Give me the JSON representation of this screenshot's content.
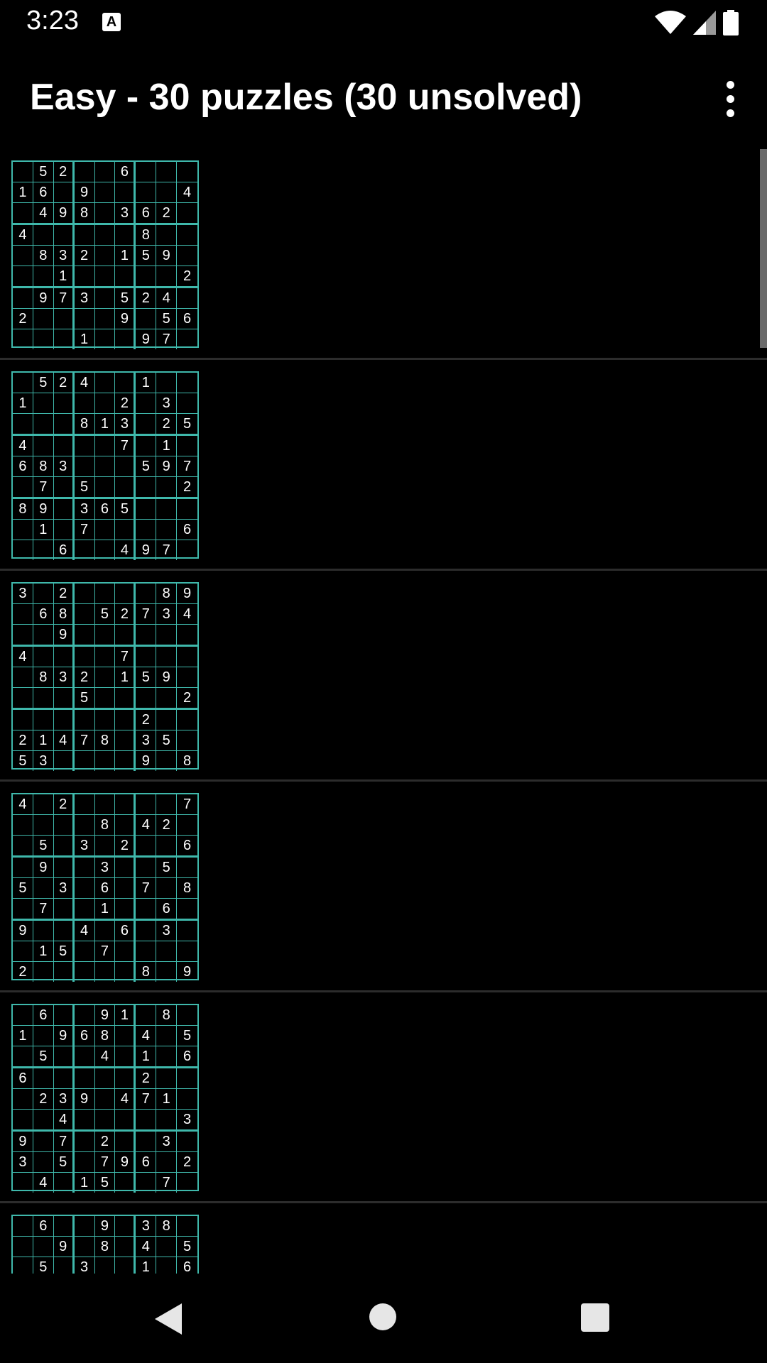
{
  "status_bar": {
    "time": "3:23",
    "notification_icon": "A",
    "icons": [
      "wifi-icon",
      "signal-icon",
      "battery-icon"
    ]
  },
  "app_bar": {
    "title": "Easy - 30 puzzles (30 unsolved)",
    "overflow_icon": "more-vert-icon"
  },
  "colors": {
    "background": "#000000",
    "grid_line": "#3fb8ab",
    "text": "#ffffff",
    "divider": "#2c2c2c"
  },
  "puzzles": [
    [
      [
        "",
        "5",
        "2",
        "",
        "",
        "6",
        "",
        "",
        ""
      ],
      [
        "1",
        "6",
        "",
        "9",
        "",
        "",
        "",
        "",
        "4"
      ],
      [
        "",
        "4",
        "9",
        "8",
        "",
        "3",
        "6",
        "2",
        ""
      ],
      [
        "4",
        "",
        "",
        "",
        "",
        "",
        "8",
        "",
        ""
      ],
      [
        "",
        "8",
        "3",
        "2",
        "",
        "1",
        "5",
        "9",
        ""
      ],
      [
        "",
        "",
        "1",
        "",
        "",
        "",
        "",
        "",
        "2"
      ],
      [
        "",
        "9",
        "7",
        "3",
        "",
        "5",
        "2",
        "4",
        ""
      ],
      [
        "2",
        "",
        "",
        "",
        "",
        "9",
        "",
        "5",
        "6"
      ],
      [
        "",
        "",
        "",
        "1",
        "",
        "",
        "9",
        "7",
        ""
      ]
    ],
    [
      [
        "",
        "5",
        "2",
        "4",
        "",
        "",
        "1",
        "",
        ""
      ],
      [
        "1",
        "",
        "",
        "",
        "",
        "2",
        "",
        "3",
        ""
      ],
      [
        "",
        "",
        "",
        "8",
        "1",
        "3",
        "",
        "2",
        "5"
      ],
      [
        "4",
        "",
        "",
        "",
        "",
        "7",
        "",
        "1",
        ""
      ],
      [
        "6",
        "8",
        "3",
        "",
        "",
        "",
        "5",
        "9",
        "7"
      ],
      [
        "",
        "7",
        "",
        "5",
        "",
        "",
        "",
        "",
        "2"
      ],
      [
        "8",
        "9",
        "",
        "3",
        "6",
        "5",
        "",
        "",
        ""
      ],
      [
        "",
        "1",
        "",
        "7",
        "",
        "",
        "",
        "",
        "6"
      ],
      [
        "",
        "",
        "6",
        "",
        "",
        "4",
        "9",
        "7",
        ""
      ]
    ],
    [
      [
        "3",
        "",
        "2",
        "",
        "",
        "",
        "",
        "8",
        "9"
      ],
      [
        "",
        "6",
        "8",
        "",
        "5",
        "2",
        "7",
        "3",
        "4"
      ],
      [
        "",
        "",
        "9",
        "",
        "",
        "",
        "",
        "",
        ""
      ],
      [
        "4",
        "",
        "",
        "",
        "",
        "7",
        "",
        "",
        ""
      ],
      [
        "",
        "8",
        "3",
        "2",
        "",
        "1",
        "5",
        "9",
        ""
      ],
      [
        "",
        "",
        "",
        "5",
        "",
        "",
        "",
        "",
        "2"
      ],
      [
        "",
        "",
        "",
        "",
        "",
        "",
        "2",
        "",
        ""
      ],
      [
        "2",
        "1",
        "4",
        "7",
        "8",
        "",
        "3",
        "5",
        ""
      ],
      [
        "5",
        "3",
        "",
        "",
        "",
        "",
        "9",
        "",
        "8"
      ]
    ],
    [
      [
        "4",
        "",
        "2",
        "",
        "",
        "",
        "",
        "",
        "7"
      ],
      [
        "",
        "",
        "",
        "",
        "8",
        "",
        "4",
        "2",
        ""
      ],
      [
        "",
        "5",
        "",
        "3",
        "",
        "2",
        "",
        "",
        "6"
      ],
      [
        "",
        "9",
        "",
        "",
        "3",
        "",
        "",
        "5",
        ""
      ],
      [
        "5",
        "",
        "3",
        "",
        "6",
        "",
        "7",
        "",
        "8"
      ],
      [
        "",
        "7",
        "",
        "",
        "1",
        "",
        "",
        "6",
        ""
      ],
      [
        "9",
        "",
        "",
        "4",
        "",
        "6",
        "",
        "3",
        ""
      ],
      [
        "",
        "1",
        "5",
        "",
        "7",
        "",
        "",
        "",
        ""
      ],
      [
        "2",
        "",
        "",
        "",
        "",
        "",
        "8",
        "",
        "9"
      ]
    ],
    [
      [
        "",
        "6",
        "",
        "",
        "9",
        "1",
        "",
        "8",
        ""
      ],
      [
        "1",
        "",
        "9",
        "6",
        "8",
        "",
        "4",
        "",
        "5"
      ],
      [
        "",
        "5",
        "",
        "",
        "4",
        "",
        "1",
        "",
        "6"
      ],
      [
        "6",
        "",
        "",
        "",
        "",
        "",
        "2",
        "",
        ""
      ],
      [
        "",
        "2",
        "3",
        "9",
        "",
        "4",
        "7",
        "1",
        ""
      ],
      [
        "",
        "",
        "4",
        "",
        "",
        "",
        "",
        "",
        "3"
      ],
      [
        "9",
        "",
        "7",
        "",
        "2",
        "",
        "",
        "3",
        ""
      ],
      [
        "3",
        "",
        "5",
        "",
        "7",
        "9",
        "6",
        "",
        "2"
      ],
      [
        "",
        "4",
        "",
        "1",
        "5",
        "",
        "",
        "7",
        ""
      ]
    ],
    [
      [
        "",
        "6",
        "",
        "",
        "9",
        "",
        "3",
        "8",
        ""
      ],
      [
        "",
        "",
        "9",
        "",
        "8",
        "",
        "4",
        "",
        "5"
      ],
      [
        "",
        "5",
        "",
        "3",
        "",
        "",
        "1",
        "",
        "6"
      ],
      [
        "",
        "",
        "",
        "",
        "",
        "",
        "",
        "",
        ""
      ],
      [
        "",
        "",
        "",
        "",
        "",
        "",
        "",
        "",
        ""
      ],
      [
        "",
        "",
        "",
        "",
        "",
        "",
        "",
        "",
        ""
      ],
      [
        "",
        "",
        "",
        "",
        "",
        "",
        "",
        "",
        ""
      ],
      [
        "",
        "",
        "",
        "",
        "",
        "",
        "",
        "",
        ""
      ],
      [
        "",
        "",
        "",
        "",
        "",
        "",
        "",
        "",
        ""
      ]
    ]
  ],
  "nav_bar": {
    "back": "back-icon",
    "home": "home-icon",
    "recents": "recents-icon"
  }
}
